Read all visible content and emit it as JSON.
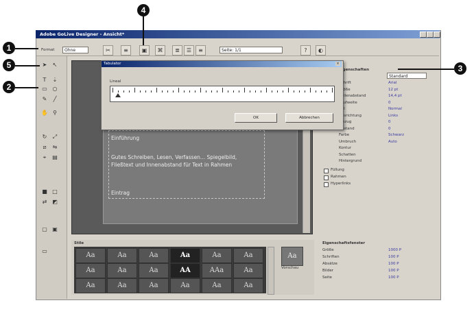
{
  "window": {
    "title": "Adobe GoLive Designer - Ansicht*"
  },
  "toolbar": {
    "style_label": "Format",
    "style_value": "Ohne",
    "page_field": "Seite: 1/1",
    "fraction_label": "1/1"
  },
  "callouts": [
    "1",
    "2",
    "3",
    "4",
    "5"
  ],
  "dialog": {
    "title": "Tabulator",
    "ruler_label": "Lineal",
    "ok": "OK",
    "cancel": "Abbrechen"
  },
  "canvas": {
    "heading": "Einführung",
    "body": "Gutes Schreiben, Lesen, Verfassen... Spiegelbild, Fließtext und Innenabstand für Text in Rahmen",
    "footer": "Eintrag"
  },
  "props": {
    "header": "Eigenschaften",
    "dropdown": "Standard",
    "rows": [
      {
        "label": "Schrift",
        "value": "Arial"
      },
      {
        "label": "Größe",
        "value": "12 pt"
      },
      {
        "label": "Zeilenabstand",
        "value": "14,4 pt"
      },
      {
        "label": "Laufweite",
        "value": "0"
      },
      {
        "label": "Stil",
        "value": "Normal"
      },
      {
        "label": "Ausrichtung",
        "value": "Links"
      },
      {
        "label": "Einzug",
        "value": "0"
      },
      {
        "label": "Abstand",
        "value": "0"
      },
      {
        "label": "Farbe",
        "value": "Schwarz"
      },
      {
        "label": "Umbruch",
        "value": "Auto"
      },
      {
        "label": "Kontur",
        "value": ""
      },
      {
        "label": "Schatten",
        "value": ""
      },
      {
        "label": "Hintergrund",
        "value": ""
      }
    ],
    "checks": [
      "Füllung",
      "Rahmen",
      "Hyperlinks"
    ]
  },
  "styles": {
    "header": "Stile",
    "cells": [
      "Aa",
      "Aa",
      "Aa",
      "Aa",
      "Aa",
      "Aa",
      "Aa",
      "Aa",
      "Aa",
      "AA",
      "AAa",
      "Aa",
      "Aa",
      "Aa",
      "Aa",
      "Aa",
      "Aa",
      "Aa"
    ],
    "preview_label": "Vorschau"
  },
  "stats": {
    "header": "Eigenschaftsfenster",
    "rows": [
      {
        "label": "Größe",
        "value": "1000 P"
      },
      {
        "label": "Schriften",
        "value": "100 P"
      },
      {
        "label": "Absätze",
        "value": "100 P"
      },
      {
        "label": "Bilder",
        "value": "100 P"
      },
      {
        "label": "Seite",
        "value": "100 P"
      }
    ]
  },
  "colors": {
    "accent": "#0a246a",
    "callout": "#111111",
    "canvas": "#5a5a5a"
  }
}
